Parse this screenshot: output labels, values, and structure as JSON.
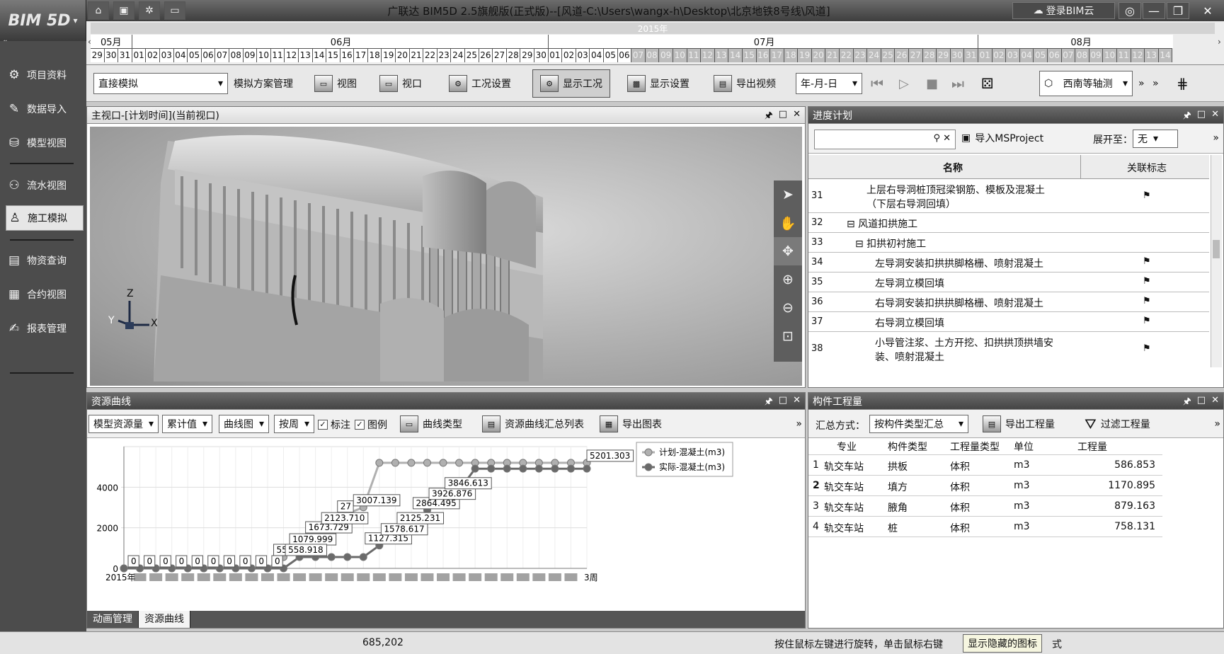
{
  "app": {
    "logo": "BIM 5D",
    "window_title": "广联达 BIM5D 2.5旗舰版(正式版)--[风道-C:\\Users\\wangx-h\\Desktop\\北京地铁8号线\\风道]",
    "cloud_login": "登录BIM云"
  },
  "timeline": {
    "year": "2015年",
    "months": [
      "05月",
      "06月",
      "07月",
      "08月"
    ],
    "days_may": [
      "29",
      "30",
      "31"
    ],
    "days_jun": [
      "01",
      "02",
      "03",
      "04",
      "05",
      "06",
      "07",
      "08",
      "09",
      "10",
      "11",
      "12",
      "13",
      "14",
      "15",
      "16",
      "17",
      "18",
      "19",
      "20",
      "21",
      "22",
      "23",
      "24",
      "25",
      "26",
      "27",
      "28",
      "29",
      "30"
    ],
    "days_jul": [
      "01",
      "02",
      "03",
      "04",
      "05",
      "06",
      "07",
      "08",
      "09",
      "10",
      "11",
      "12",
      "13",
      "14",
      "15",
      "16",
      "17",
      "18",
      "19",
      "20",
      "21",
      "22",
      "23",
      "24",
      "25",
      "26",
      "27",
      "28",
      "29",
      "30",
      "31"
    ],
    "days_aug": [
      "01",
      "02",
      "03",
      "04",
      "05",
      "06",
      "07",
      "08",
      "09",
      "10",
      "11",
      "12",
      "13",
      "14"
    ]
  },
  "sidebar": {
    "items": [
      {
        "label": "项目资料",
        "icon": "gear-stack-icon"
      },
      {
        "label": "数据导入",
        "icon": "import-icon"
      },
      {
        "label": "模型视图",
        "icon": "model-icon"
      },
      {
        "label": "流水视图",
        "icon": "flow-icon"
      },
      {
        "label": "施工模拟",
        "icon": "worker-icon"
      },
      {
        "label": "物资查询",
        "icon": "material-icon"
      },
      {
        "label": "合约视图",
        "icon": "contract-icon"
      },
      {
        "label": "报表管理",
        "icon": "report-icon"
      }
    ]
  },
  "toolbar": {
    "sim_mode": "直接模拟",
    "plan_mgmt": "模拟方案管理",
    "view": "视图",
    "viewport": "视口",
    "condition_settings": "工况设置",
    "show_condition": "显示工况",
    "display_settings": "显示设置",
    "export_video": "导出视频",
    "date_format": "年-月-日",
    "view_direction": "西南等轴测"
  },
  "viewport": {
    "title": "主视口-[计划时间](当前视口)",
    "axis": {
      "z": "Z",
      "y": "Y",
      "x": "X"
    }
  },
  "schedule": {
    "title": "进度计划",
    "search_placeholder": "",
    "import_label": "导入MSProject",
    "expand_label": "展开至：",
    "expand_value": "无",
    "col_name": "名称",
    "col_flag": "关联标志",
    "rows": [
      {
        "num": "31",
        "name": "上层右导洞桩顶冠梁钢筋、模板及混凝土",
        "name2": "（下层右导洞回填）",
        "flag": "⚑"
      },
      {
        "num": "32",
        "name": "⊟ 风道扣拱施工",
        "flag": ""
      },
      {
        "num": "33",
        "name": "⊟ 扣拱初衬施工",
        "flag": ""
      },
      {
        "num": "34",
        "name": "左导洞安装扣拱拱脚格栅、喷射混凝土",
        "flag": "⚑"
      },
      {
        "num": "35",
        "name": "左导洞立模回填",
        "flag": "⚑"
      },
      {
        "num": "36",
        "name": "右导洞安装扣拱拱脚格栅、喷射混凝土",
        "flag": "⚑"
      },
      {
        "num": "37",
        "name": "右导洞立模回填",
        "flag": "⚑"
      },
      {
        "num": "38",
        "name": "小导管注浆、土方开挖、扣拱拱顶拱墙安",
        "name2": "装、喷射混凝土",
        "flag": "⚑"
      }
    ]
  },
  "resource": {
    "title": "资源曲线",
    "model_qty": "模型资源量",
    "cumulative": "累计值",
    "curve_chart": "曲线图",
    "by_week": "按周",
    "label_check": "标注",
    "legend_check": "图例",
    "curve_type": "曲线类型",
    "summary_list": "资源曲线汇总列表",
    "export_chart": "导出图表",
    "tabs": [
      "动画管理",
      "资源曲线"
    ]
  },
  "chart_data": {
    "type": "line",
    "title": "",
    "xlabel": "",
    "ylabel": "",
    "ylim": [
      0,
      6000
    ],
    "y_ticks": [
      "0",
      "2000",
      "4000"
    ],
    "x_first_label": "2015年",
    "x_last_label": "3周",
    "weeks": 30,
    "series": [
      {
        "name": "计划-混凝土(m3)",
        "color": "#b0b0b0",
        "values": [
          0,
          0,
          0,
          0,
          0,
          0,
          0,
          0,
          0,
          0,
          558.918,
          1079.999,
          1673.729,
          2123.71,
          2700,
          3007.139,
          5201.303,
          5201.303,
          5201.303,
          5201.303,
          5201.303,
          5201.303,
          5201.303,
          5201.303,
          5201.303,
          5201.303,
          5201.303,
          5201.303,
          5201.303,
          5201.303
        ]
      },
      {
        "name": "实际-混凝土(m3)",
        "color": "#6a6a6a",
        "values": [
          0,
          0,
          0,
          0,
          0,
          0,
          0,
          0,
          0,
          0,
          0,
          558.918,
          558.918,
          558.918,
          558.918,
          558.918,
          1127.315,
          1578.617,
          2125.231,
          2864.495,
          3326.876,
          3846.613,
          4913,
          4913,
          4913,
          4913,
          4913,
          4913,
          4913,
          4913
        ]
      }
    ],
    "point_labels": [
      {
        "text": "0"
      },
      {
        "text": "0"
      },
      {
        "text": "0"
      },
      {
        "text": "0"
      },
      {
        "text": "0"
      },
      {
        "text": "0"
      },
      {
        "text": "0"
      },
      {
        "text": "0"
      },
      {
        "text": "0"
      },
      {
        "text": "0"
      },
      {
        "text": "558.918"
      },
      {
        "text": "1079.999"
      },
      {
        "text": "1673.729"
      },
      {
        "text": "2123.710"
      },
      {
        "text": "27"
      },
      {
        "text": "3007.139"
      },
      {
        "text": "558.918"
      },
      {
        "text": "1127.315"
      },
      {
        "text": "1578.617"
      },
      {
        "text": "2125.231"
      },
      {
        "text": "2864.495"
      },
      {
        "text": "3926.876"
      },
      {
        "text": "3846.613"
      },
      {
        "text": "5201.303"
      }
    ],
    "legend_position": "top-right"
  },
  "quantities": {
    "title": "构件工程量",
    "summary_mode_label": "汇总方式：",
    "summary_mode_value": "按构件类型汇总",
    "export_label": "导出工程量",
    "filter_label": "过滤工程量",
    "headers": [
      "专业",
      "构件类型",
      "工程量类型",
      "单位",
      "工程量"
    ],
    "rows": [
      [
        "1",
        "轨交车站",
        "拱板",
        "体积",
        "m3",
        "586.853"
      ],
      [
        "2",
        "轨交车站",
        "填方",
        "体积",
        "m3",
        "1170.895"
      ],
      [
        "3",
        "轨交车站",
        "腋角",
        "体积",
        "m3",
        "879.163"
      ],
      [
        "4",
        "轨交车站",
        "桩",
        "体积",
        "m3",
        "758.131"
      ]
    ]
  },
  "status": {
    "coords": "685,202",
    "hint": "按住鼠标左键进行旋转，单击鼠标右键",
    "tooltip": "显示隐藏的图标",
    "tail": "式"
  }
}
